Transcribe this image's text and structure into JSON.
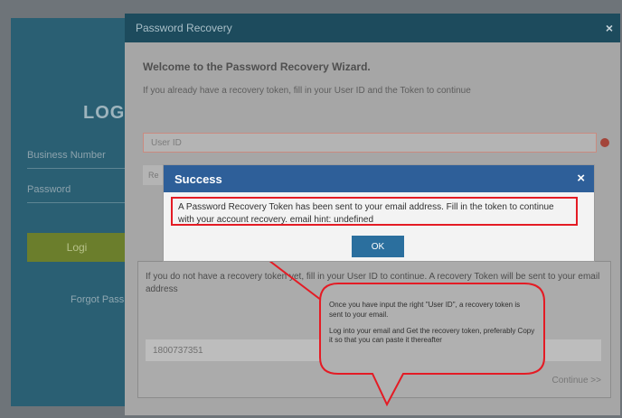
{
  "background": {
    "login": {
      "title": "LOGI",
      "username": "Business Number",
      "password": "Password",
      "button": "Logi",
      "forgot": "Forgot Pass"
    }
  },
  "recovery_dialog": {
    "title": "Password Recovery",
    "close": "×",
    "welcome": "Welcome to the Password Recovery Wizard.",
    "intro": "If you already have a recovery token, fill in your User ID and the Token to continue",
    "userid_placeholder": "User ID",
    "partial_field": "Re",
    "lower_text": "If you do not have a recovery token yet, fill in your User ID to continue. A recovery Token will be sent to your email address",
    "token_value": "1800737351",
    "continue": "Continue >>"
  },
  "success_modal": {
    "title": "Success",
    "close": "×",
    "message": "A Password Recovery Token has been sent to your email address. Fill in the token to continue with your account recovery. email hint: undefined",
    "ok": "OK"
  },
  "callout": {
    "line1": "Once you have input the right \"User ID\", a recovery token is sent to your email.",
    "line2": "Log into your email and Get the recovery token, preferably Copy it so that you can paste it thereafter"
  },
  "colors": {
    "highlight": "#e41b24",
    "modal_header": "#2e5f99",
    "ok_button": "#2b6f9e",
    "dialog_header": "#1d4b5d"
  }
}
